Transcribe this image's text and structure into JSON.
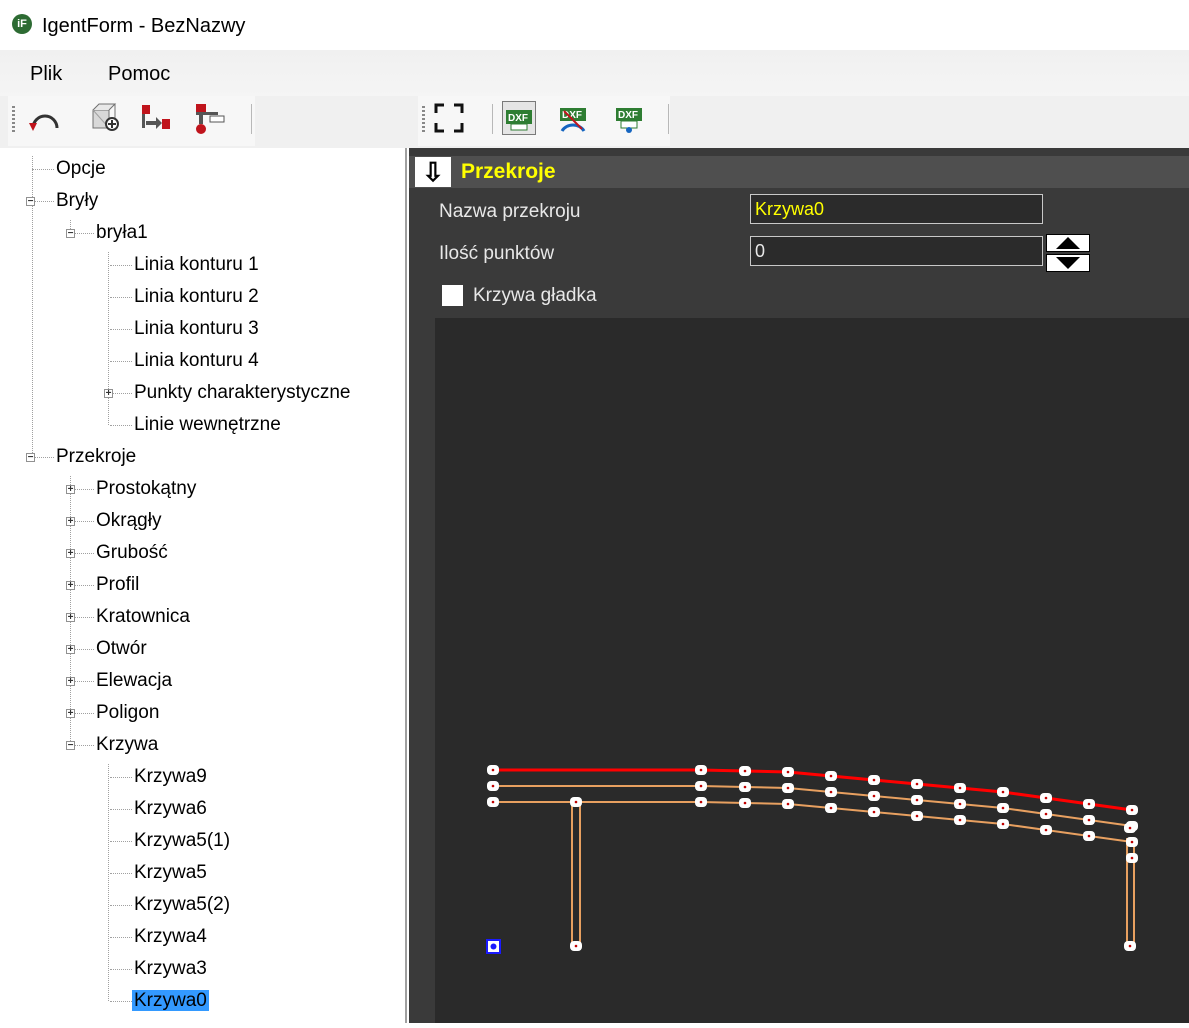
{
  "window": {
    "title": "IgentForm - BezNazwy",
    "icon": "igentform-app-icon"
  },
  "menu": {
    "items": [
      "Plik",
      "Pomoc"
    ]
  },
  "toolbar_left": {
    "icons": [
      "rotate-arc-icon",
      "add-solid-icon",
      "section-move-icon",
      "section-profile-icon"
    ]
  },
  "toolbar_right": {
    "icons": [
      "fit-view-icon",
      "dxf-export-icon",
      "dxf-curve-icon",
      "dxf-points-icon"
    ]
  },
  "tree": {
    "nodes": [
      {
        "label": "Opcje",
        "level": 0,
        "expander": "none"
      },
      {
        "label": "Bryły",
        "level": 0,
        "expander": "minus"
      },
      {
        "label": "bryła1",
        "level": 1,
        "expander": "minus"
      },
      {
        "label": "Linia konturu 1",
        "level": 2,
        "expander": "none"
      },
      {
        "label": "Linia konturu 2",
        "level": 2,
        "expander": "none"
      },
      {
        "label": "Linia konturu 3",
        "level": 2,
        "expander": "none"
      },
      {
        "label": "Linia konturu 4",
        "level": 2,
        "expander": "none"
      },
      {
        "label": "Punkty charakterystyczne",
        "level": 2,
        "expander": "plus"
      },
      {
        "label": "Linie wewnętrzne",
        "level": 2,
        "expander": "none"
      },
      {
        "label": "Przekroje",
        "level": 0,
        "expander": "minus"
      },
      {
        "label": "Prostokątny",
        "level": 1,
        "expander": "plus"
      },
      {
        "label": "Okrągły",
        "level": 1,
        "expander": "plus"
      },
      {
        "label": "Grubość",
        "level": 1,
        "expander": "plus"
      },
      {
        "label": "Profil",
        "level": 1,
        "expander": "plus"
      },
      {
        "label": "Kratownica",
        "level": 1,
        "expander": "plus"
      },
      {
        "label": "Otwór",
        "level": 1,
        "expander": "plus"
      },
      {
        "label": "Elewacja",
        "level": 1,
        "expander": "plus"
      },
      {
        "label": "Poligon",
        "level": 1,
        "expander": "plus"
      },
      {
        "label": "Krzywa",
        "level": 1,
        "expander": "minus"
      },
      {
        "label": "Krzywa9",
        "level": 2,
        "expander": "none"
      },
      {
        "label": "Krzywa6",
        "level": 2,
        "expander": "none"
      },
      {
        "label": "Krzywa5(1)",
        "level": 2,
        "expander": "none"
      },
      {
        "label": "Krzywa5",
        "level": 2,
        "expander": "none"
      },
      {
        "label": "Krzywa5(2)",
        "level": 2,
        "expander": "none"
      },
      {
        "label": "Krzywa4",
        "level": 2,
        "expander": "none"
      },
      {
        "label": "Krzywa3",
        "level": 2,
        "expander": "none"
      },
      {
        "label": "Krzywa0",
        "level": 2,
        "expander": "none",
        "selected": true
      }
    ]
  },
  "panel": {
    "header_icon": "arrow-down-icon",
    "header": "Przekroje",
    "name_label": "Nazwa przekroju",
    "name_value": "Krzywa0",
    "points_label": "Ilość punktów",
    "points_value": "0",
    "smooth_label": "Krzywa gładka",
    "smooth_checked": false
  },
  "colors": {
    "accent_text": "#ffff00",
    "curve_red": "#ff0000",
    "curve_orange": "#e8a060",
    "selection": "#3399ff",
    "panel_bg": "#3a3a3a",
    "canvas_bg": "#2a2a2a"
  }
}
